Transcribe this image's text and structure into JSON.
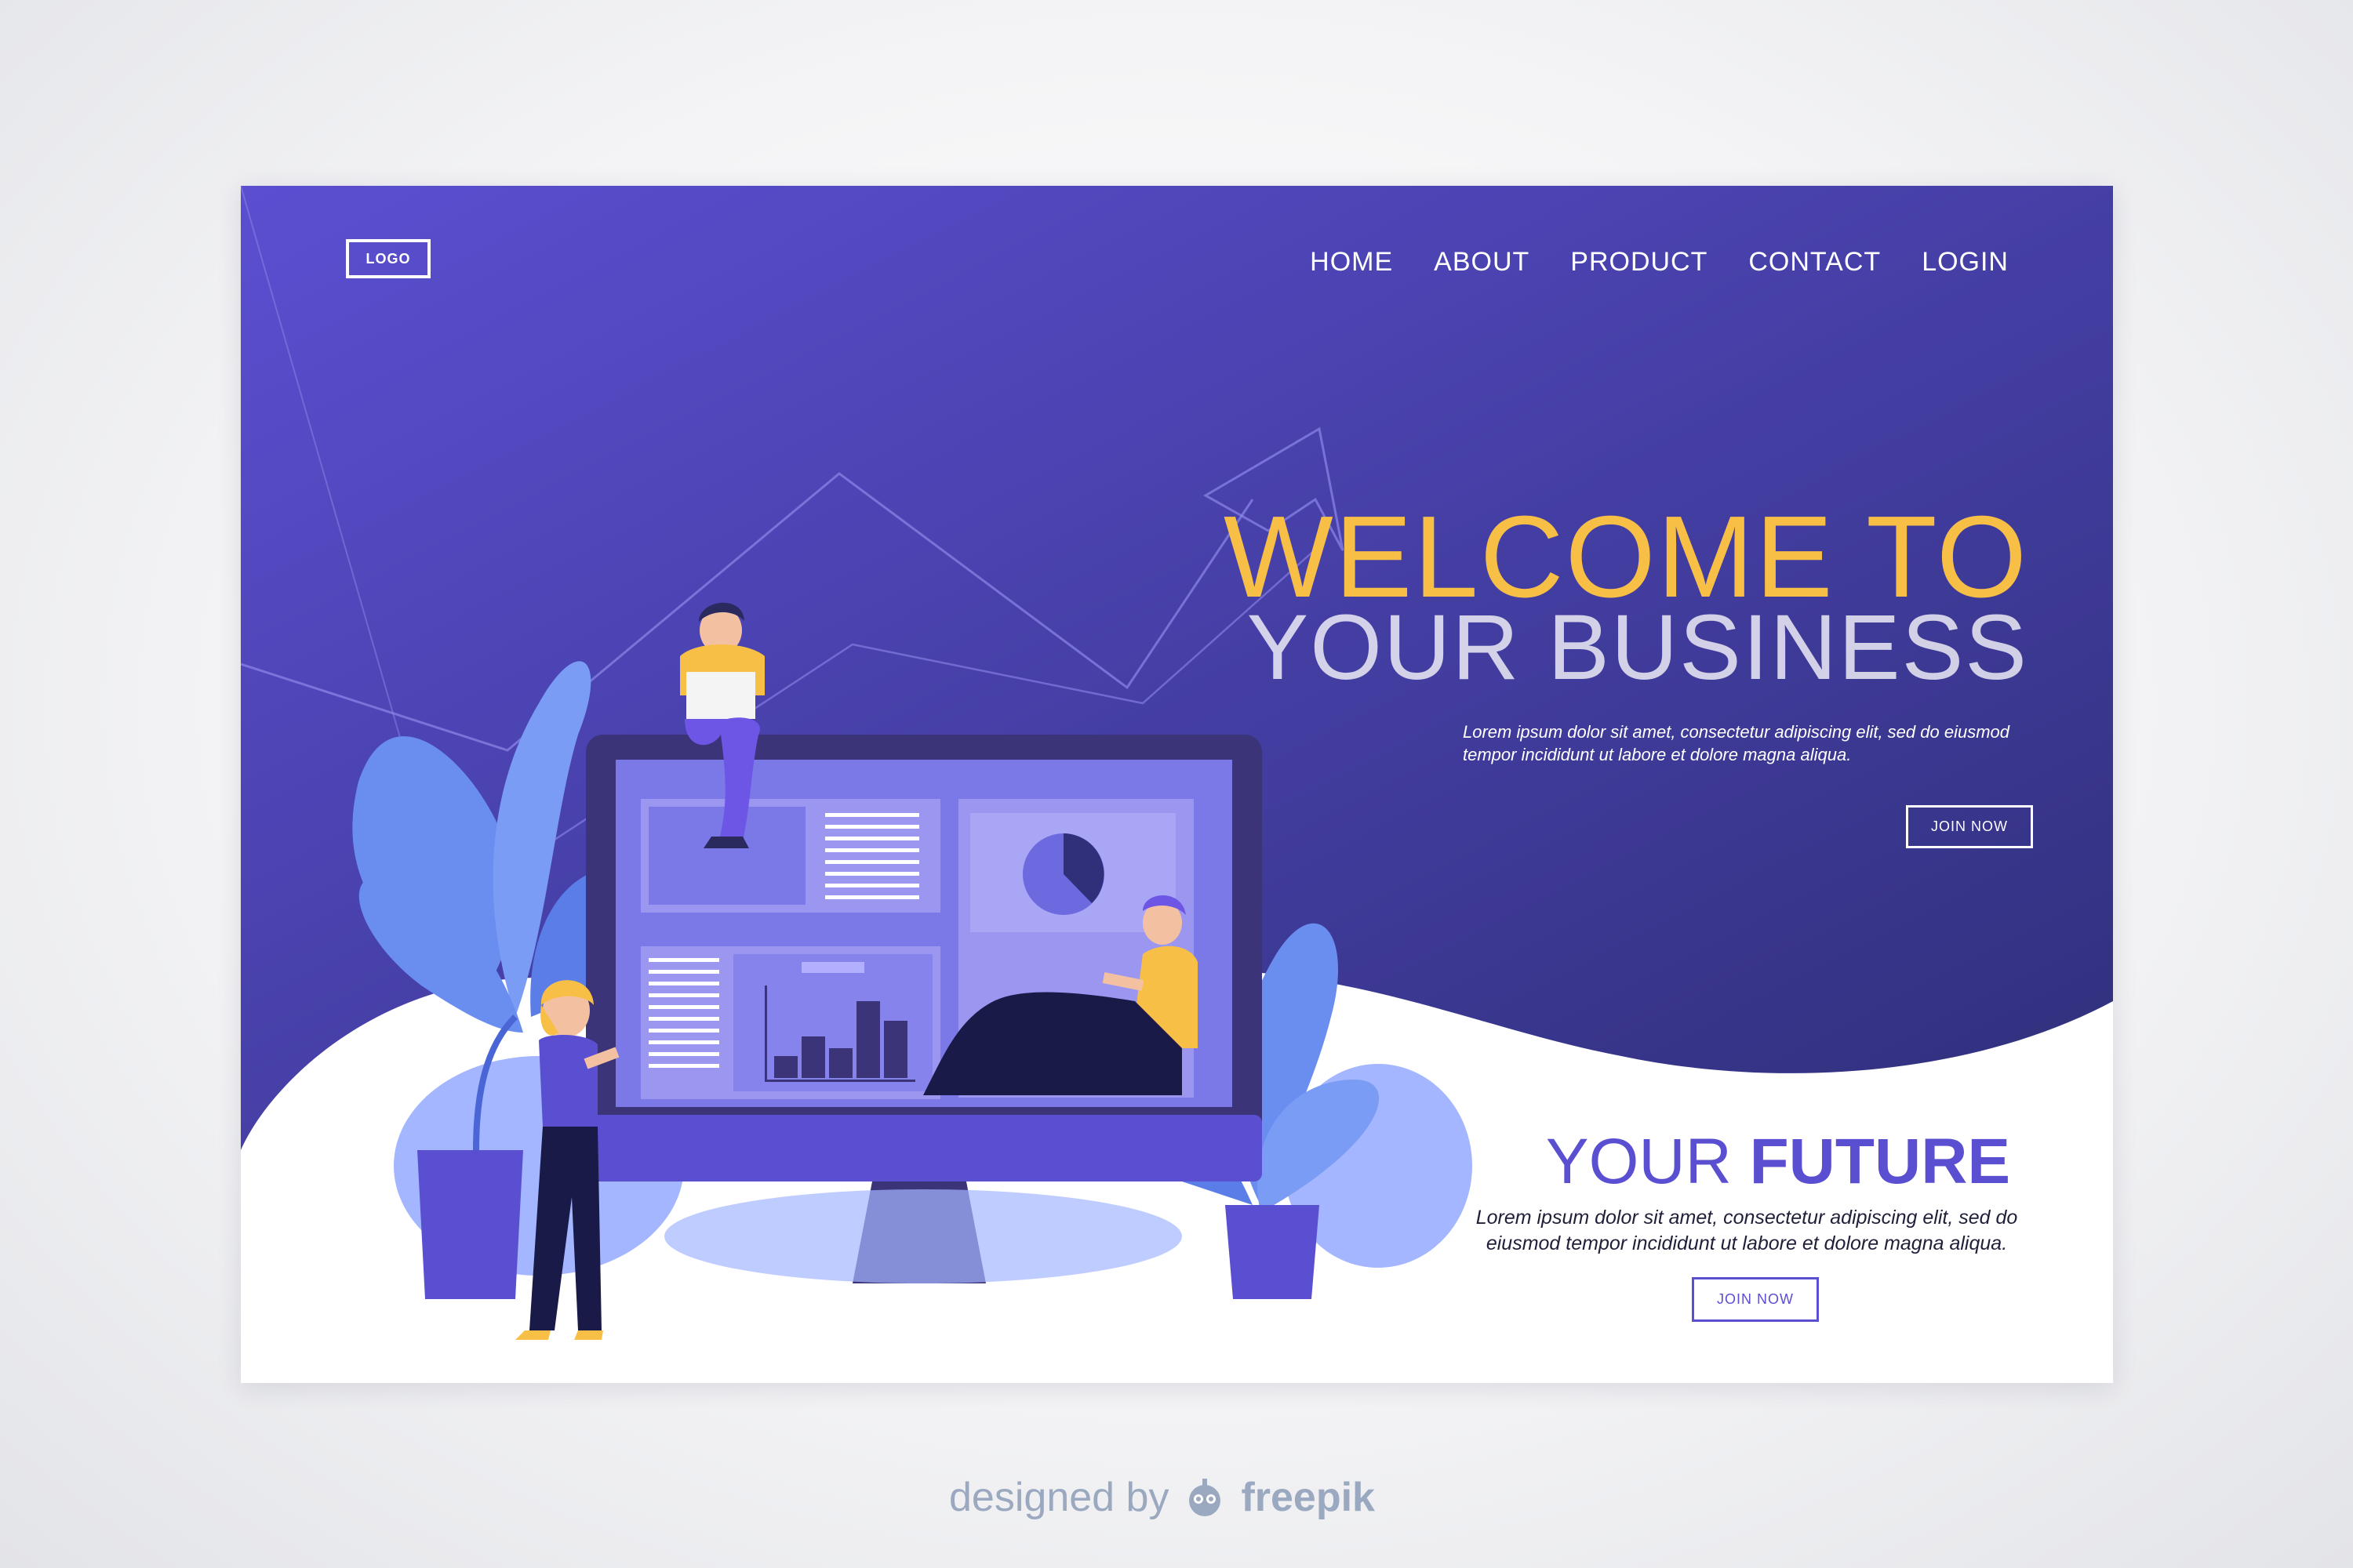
{
  "header": {
    "logo_label": "LOGO",
    "nav": [
      "HOME",
      "ABOUT",
      "PRODUCT",
      "CONTACT",
      "LOGIN"
    ]
  },
  "hero": {
    "headline_line1": "WELCOME TO",
    "headline_line2": "YOUR BUSINESS",
    "description": "Lorem ipsum dolor sit amet, consectetur adipiscing elit, sed do eiusmod tempor incididunt ut labore et dolore magna aliqua.",
    "cta_label": "JOIN NOW"
  },
  "future": {
    "title_light": "YOUR",
    "title_bold": "FUTURE",
    "description": "Lorem ipsum dolor sit amet, consectetur adipiscing elit, sed do eiusmod tempor incididunt ut labore et dolore magna aliqua.",
    "cta_label": "JOIN NOW"
  },
  "footer": {
    "designed_by": "designed by",
    "brand": "freepik"
  },
  "colors": {
    "hero_gradient_top": "#5b4fd1",
    "hero_gradient_bottom": "#2f2f7a",
    "accent_yellow": "#f7bf45",
    "accent_purple": "#5b4fd1"
  }
}
